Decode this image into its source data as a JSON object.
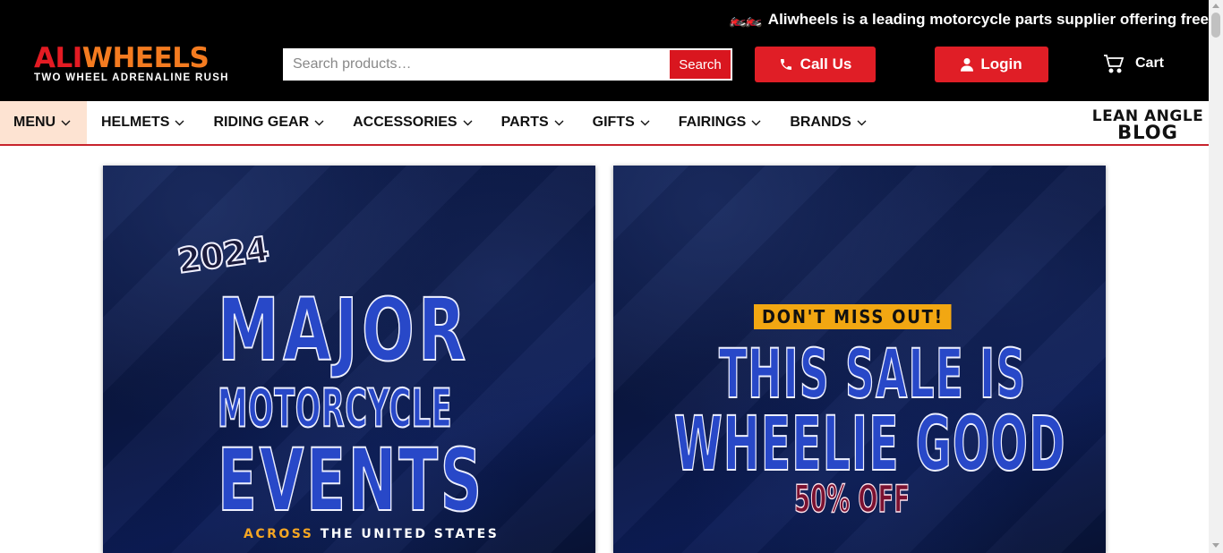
{
  "ticker": {
    "bikes": "🏍️🏍️",
    "text": "Aliwheels is a leading motorcycle parts supplier offering free"
  },
  "logo": {
    "part1": "ALI",
    "part2": "WHEELS",
    "tagline": "TWO WHEEL ADRENALINE RUSH"
  },
  "search": {
    "placeholder": "Search products…",
    "button_label": "Search"
  },
  "header": {
    "call_label": "Call Us",
    "login_label": "Login",
    "cart_label": "Cart"
  },
  "nav": {
    "items": [
      {
        "label": "MENU"
      },
      {
        "label": "HELMETS"
      },
      {
        "label": "RIDING GEAR"
      },
      {
        "label": "ACCESSORIES"
      },
      {
        "label": "PARTS"
      },
      {
        "label": "GIFTS"
      },
      {
        "label": "FAIRINGS"
      },
      {
        "label": "BRANDS"
      }
    ],
    "blog_line1": "LEAN ANGLE",
    "blog_line2": "BLOG"
  },
  "banners": {
    "events": {
      "year": "2024",
      "line1": "MAJOR",
      "line2": "MOTORCYCLE",
      "line3": "EVENTS",
      "sub_orange": "ACROSS",
      "sub_white": " THE UNITED STATES"
    },
    "sale": {
      "tag": "DON'T MISS OUT!",
      "line1": "THIS SALE IS",
      "line2": "WHEELIE GOOD",
      "discount": "50% OFF"
    }
  },
  "colors": {
    "brand_red": "#e01e26",
    "brand_orange": "#f47b20",
    "menu_highlight": "#fde3d2"
  }
}
